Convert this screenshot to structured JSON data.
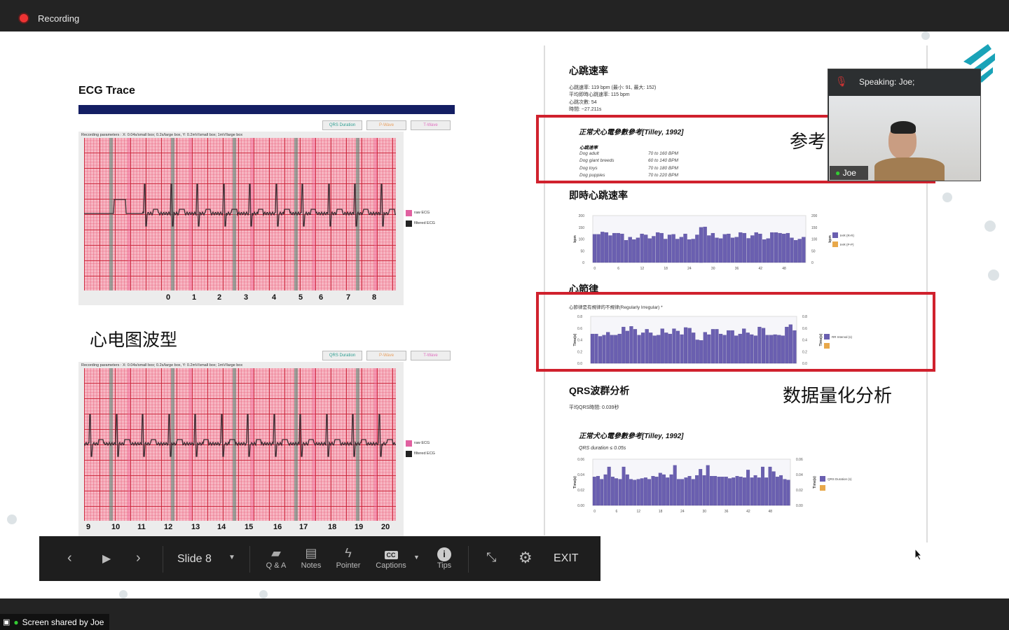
{
  "topbar": {
    "recording_label": "Recording"
  },
  "share_bar": {
    "label": "Screen shared by Joe"
  },
  "slide": {
    "left": {
      "title": "ECG Trace",
      "buttons": [
        "QRS Duration",
        "P-Wave",
        "T-Wave"
      ],
      "recording_params": "Recording parameters : X: 0.04s/small box; 0.2s/large box, Y: 0.2mV/small box; 1mV/large box",
      "legend": [
        "raw ECG",
        "filtered ECG"
      ],
      "panel1_ticks": [
        "0",
        "1",
        "2",
        "3",
        "4",
        "5",
        "6",
        "7",
        "8"
      ],
      "panel2_ticks": [
        "9",
        "10",
        "11",
        "12",
        "13",
        "14",
        "15",
        "16",
        "17",
        "18",
        "19",
        "20"
      ],
      "caption": "心电图波型"
    },
    "right": {
      "hr_section": {
        "title": "心跳速率",
        "lines": [
          "心跳速率: 119 bpm (最小: 91, 最大: 152)",
          "平均即時心跳速率: 115 bpm",
          "心跳次數: 54",
          "時間: ~27.211s"
        ]
      },
      "ref_box": {
        "title": "正常犬心電參數參考[Tilley, 1992]",
        "subtitle": "心跳速率",
        "rows": [
          {
            "label": "Dog adult",
            "value": "70 to 160 BPM"
          },
          {
            "label": "Dog giant breeds",
            "value": "60 to 140 BPM"
          },
          {
            "label": "Dog toys",
            "value": "70 to 180 BPM"
          },
          {
            "label": "Dog puppies",
            "value": "70 to 220 BPM"
          }
        ]
      },
      "annotation_ref": "参考",
      "ihr_section": {
        "title": "即時心跳速率"
      },
      "rhythm_section": {
        "title": "心節律",
        "subtitle": "心節律是有規律的不規律(Regularly Irregular) *"
      },
      "qrs_section": {
        "title": "QRS波群分析",
        "avg": "平均QRS時間: 0.039秒",
        "ref_title": "正常犬心電參數參考[Tilley, 1992]",
        "ref_line": "QRS duration ≤ 0.05s"
      },
      "annotation_quant": "数据量化分析"
    }
  },
  "chart_data": [
    {
      "type": "bar",
      "ylabel": "bpm",
      "ylim": [
        0,
        200
      ],
      "yticks": [
        "0",
        "50",
        "100",
        "150",
        "200"
      ],
      "xticks": [
        "0",
        "6",
        "12",
        "18",
        "24",
        "30",
        "36",
        "42",
        "48"
      ],
      "legend": [
        "IHR (R-R)",
        "IHR (P-P)"
      ],
      "colors": [
        "#6a5fb0",
        "#e8a84a"
      ],
      "values": [
        120,
        120,
        130,
        128,
        115,
        125,
        125,
        122,
        95,
        108,
        98,
        105,
        122,
        118,
        102,
        112,
        128,
        125,
        100,
        118,
        120,
        100,
        108,
        122,
        98,
        100,
        118,
        150,
        152,
        115,
        125,
        105,
        102,
        120,
        122,
        105,
        108,
        128,
        125,
        103,
        115,
        128,
        122,
        98,
        102,
        128,
        128,
        125,
        122,
        125,
        105,
        95,
        100,
        108
      ]
    },
    {
      "type": "bar",
      "ylabel": "Time(s)",
      "ylim": [
        0,
        0.8
      ],
      "yticks": [
        "0.0",
        "0.2",
        "0.4",
        "0.6",
        "0.8"
      ],
      "xticks": [],
      "legend": [
        "RR Interval (s)",
        ""
      ],
      "colors": [
        "#6a5fb0",
        "#e8a84a"
      ],
      "values": [
        0.5,
        0.5,
        0.46,
        0.48,
        0.53,
        0.48,
        0.48,
        0.5,
        0.62,
        0.55,
        0.63,
        0.58,
        0.48,
        0.52,
        0.58,
        0.52,
        0.47,
        0.48,
        0.59,
        0.52,
        0.5,
        0.59,
        0.55,
        0.49,
        0.61,
        0.6,
        0.52,
        0.4,
        0.39,
        0.53,
        0.49,
        0.58,
        0.58,
        0.5,
        0.48,
        0.56,
        0.56,
        0.47,
        0.5,
        0.59,
        0.52,
        0.49,
        0.47,
        0.62,
        0.6,
        0.48,
        0.48,
        0.49,
        0.48,
        0.47,
        0.62,
        0.66,
        0.56
      ]
    },
    {
      "type": "bar",
      "ylabel": "Time(s)",
      "ylim": [
        0,
        0.06
      ],
      "yticks": [
        "0.00",
        "0.02",
        "0.04",
        "0.06"
      ],
      "xticks": [
        "0",
        "6",
        "12",
        "18",
        "24",
        "30",
        "36",
        "42",
        "48"
      ],
      "legend": [
        "QRS Duration (s)",
        ""
      ],
      "colors": [
        "#6a5fb0",
        "#e8a84a"
      ],
      "values": [
        0.037,
        0.038,
        0.034,
        0.04,
        0.05,
        0.037,
        0.035,
        0.034,
        0.05,
        0.04,
        0.034,
        0.033,
        0.034,
        0.035,
        0.036,
        0.034,
        0.038,
        0.037,
        0.042,
        0.04,
        0.036,
        0.04,
        0.052,
        0.034,
        0.034,
        0.036,
        0.038,
        0.034,
        0.039,
        0.047,
        0.039,
        0.052,
        0.038,
        0.038,
        0.037,
        0.037,
        0.037,
        0.035,
        0.036,
        0.038,
        0.037,
        0.036,
        0.046,
        0.036,
        0.039,
        0.036,
        0.05,
        0.036,
        0.05,
        0.044,
        0.037,
        0.039,
        0.034,
        0.033
      ]
    }
  ],
  "video": {
    "speaking": "Speaking: Joe;",
    "name": "Joe"
  },
  "toolbar": {
    "slide_label": "Slide 8",
    "qa": "Q & A",
    "notes": "Notes",
    "pointer": "Pointer",
    "captions": "Captions",
    "tips": "Tips",
    "exit": "EXIT"
  }
}
